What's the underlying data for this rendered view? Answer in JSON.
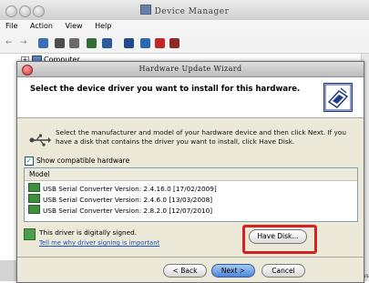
{
  "outer_window": {
    "title": "Device Manager",
    "menu": [
      "File",
      "Action",
      "View",
      "Help"
    ],
    "tree_root": "Computer"
  },
  "wizard": {
    "title": "Hardware Update Wizard",
    "heading": "Select the device driver you want to install for this hardware.",
    "instruction": "Select the manufacturer and model of your hardware device and then click Next. If you have a disk that contains the driver you want to install, click Have Disk.",
    "show_compatible_label": "Show compatible hardware",
    "show_compatible_checked": true,
    "model_header": "Model",
    "models": [
      "USB Serial Converter Version: 2.4.16.0 [17/02/2009]",
      "USB Serial Converter Version: 2.4.6.0 [13/03/2008]",
      "USB Serial Converter Version: 2.8.2.0 [12/07/2010]"
    ],
    "signed_text": "This driver is digitally signed.",
    "signed_link": "Tell me why driver signing is important",
    "have_disk_label": "Have Disk...",
    "buttons": {
      "back": "< Back",
      "next": "Next >",
      "cancel": "Cancel"
    }
  },
  "background_fragment": "Windows",
  "colors": {
    "highlight_border": "#d42121",
    "link": "#1750c8",
    "next_button": "#4e86d8"
  }
}
